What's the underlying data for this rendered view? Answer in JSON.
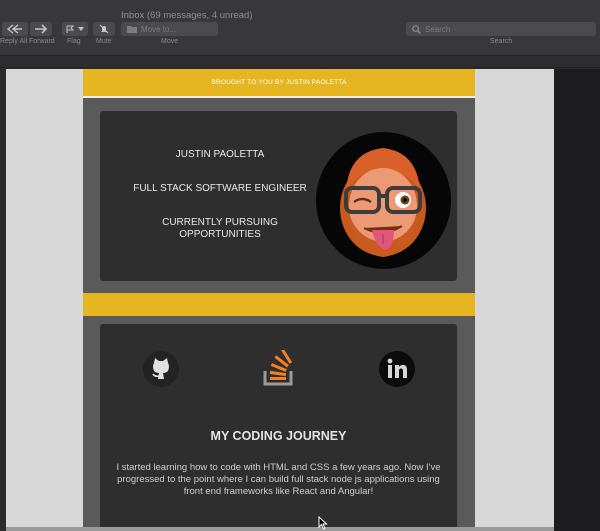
{
  "window": {
    "title": "Inbox (69 messages, 4 unread)"
  },
  "toolbar": {
    "reply_all_label": "Reply All",
    "forward_label": "Forward",
    "flag_label": "Flag",
    "mute_label": "Mute",
    "move_label": "Move",
    "move_placeholder": "Move to...",
    "search_label": "Search",
    "search_placeholder": "Search"
  },
  "email": {
    "banner": "BROUGHT TO YOU BY JUSTIN PAOLETTA",
    "intro": {
      "name": "JUSTIN PAOLETTA",
      "role": "FULL STACK SOFTWARE ENGINEER",
      "status": "CURRENTLY PURSUING OPPORTUNITIES"
    },
    "journey": {
      "title": "MY CODING JOURNEY",
      "body": "I started learning how to code with HTML and CSS a few years ago. Now I've progressed to the point where I can build full stack node js applications using front end frameworks like React and Angular!"
    },
    "social": [
      "github-icon",
      "stackoverflow-icon",
      "linkedin-icon"
    ]
  },
  "colors": {
    "accent": "#e5b622",
    "email_bg": "#5a5a5a",
    "card_bg": "#2e2e2f",
    "toolbar_bg": "#38383a"
  }
}
